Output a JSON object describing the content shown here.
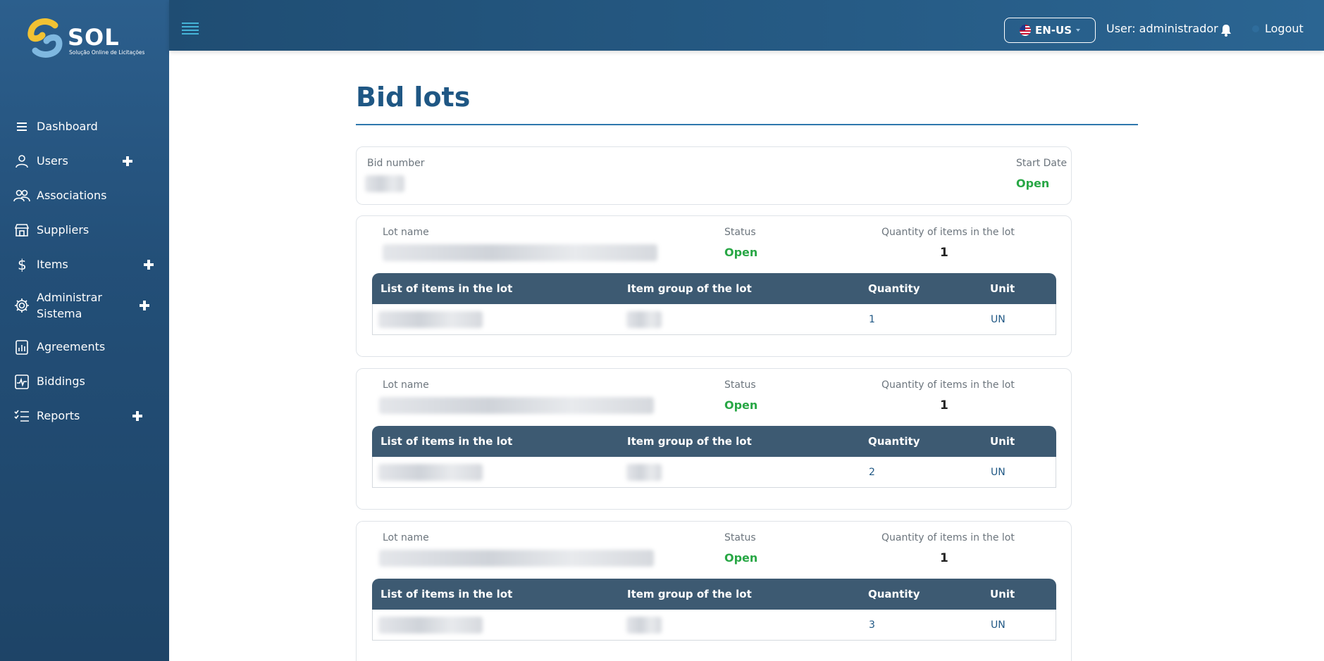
{
  "brand": {
    "name": "SOL",
    "tagline": "Solução Online de Licitações"
  },
  "sidebar": {
    "items": [
      {
        "label": "Dashboard",
        "icon": "menu-lines-icon",
        "expandable": false
      },
      {
        "label": "Users",
        "icon": "user-icon",
        "expandable": true
      },
      {
        "label": "Associations",
        "icon": "users-group-icon",
        "expandable": false
      },
      {
        "label": "Suppliers",
        "icon": "store-icon",
        "expandable": false
      },
      {
        "label": "Items",
        "icon": "dollar-icon",
        "expandable": true
      },
      {
        "label": "Administrar Sistema",
        "icon": "gear-icon",
        "expandable": true
      },
      {
        "label": "Agreements",
        "icon": "chart-doc-icon",
        "expandable": false
      },
      {
        "label": "Biddings",
        "icon": "pulse-doc-icon",
        "expandable": false
      },
      {
        "label": "Reports",
        "icon": "list-check-icon",
        "expandable": true
      }
    ]
  },
  "topbar": {
    "language": "EN-US",
    "user": "User: administrador",
    "logout": "Logout"
  },
  "page": {
    "title": "Bid lots",
    "bid": {
      "number_label": "Bid number",
      "start_label": "Start Date",
      "start_value": "Open"
    },
    "lot_labels": {
      "name": "Lot name",
      "status": "Status",
      "qty": "Quantity of items in the lot"
    },
    "table_headers": {
      "items": "List of items in the lot",
      "group": "Item group of the lot",
      "quantity": "Quantity",
      "unit": "Unit"
    },
    "lots": [
      {
        "status": "Open",
        "qty_items": "1",
        "row_quantity": "1",
        "row_unit": "UN"
      },
      {
        "status": "Open",
        "qty_items": "1",
        "row_quantity": "2",
        "row_unit": "UN"
      },
      {
        "status": "Open",
        "qty_items": "1",
        "row_quantity": "3",
        "row_unit": "UN"
      }
    ]
  },
  "colors": {
    "sidebar": "#234f78",
    "accent": "#1f5784",
    "open_status": "#28a745",
    "table_header": "#3d5a72"
  }
}
